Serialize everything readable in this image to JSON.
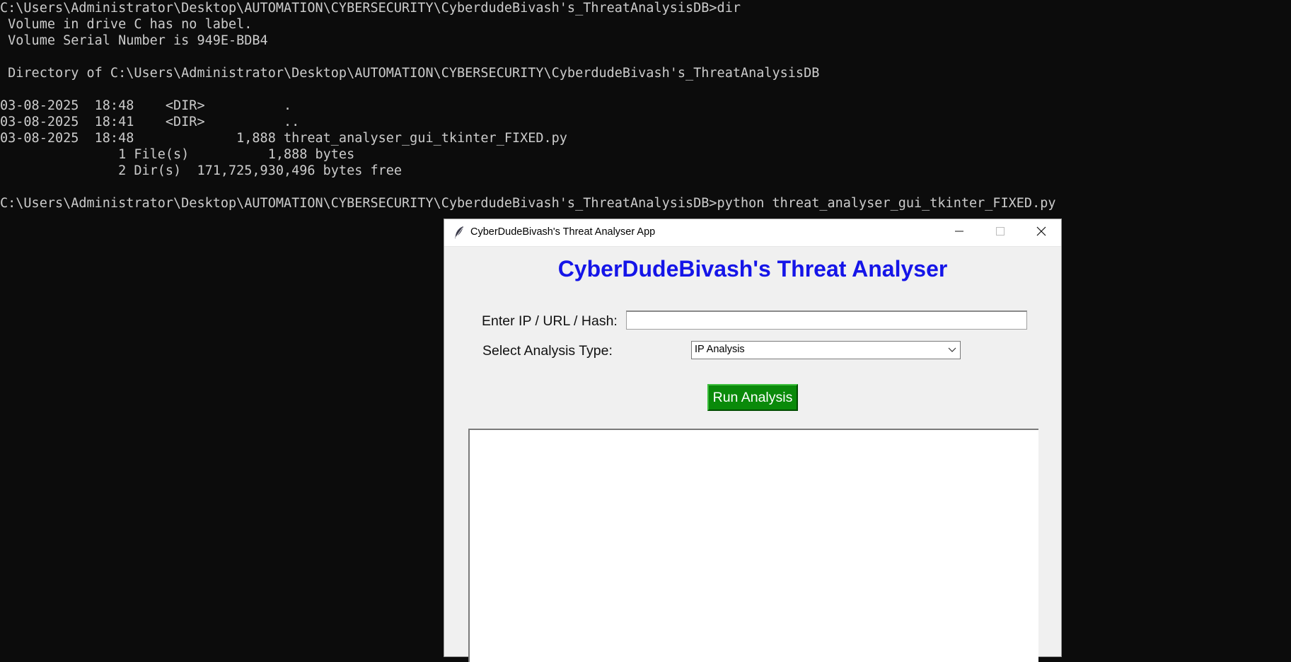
{
  "terminal": {
    "lines": [
      "C:\\Users\\Administrator\\Desktop\\AUTOMATION\\CYBERSECURITY\\CyberdudeBivash's_ThreatAnalysisDB>dir",
      " Volume in drive C has no label.",
      " Volume Serial Number is 949E-BDB4",
      "",
      " Directory of C:\\Users\\Administrator\\Desktop\\AUTOMATION\\CYBERSECURITY\\CyberdudeBivash's_ThreatAnalysisDB",
      "",
      "03-08-2025  18:48    <DIR>          .",
      "03-08-2025  18:41    <DIR>          ..",
      "03-08-2025  18:48             1,888 threat_analyser_gui_tkinter_FIXED.py",
      "               1 File(s)          1,888 bytes",
      "               2 Dir(s)  171,725,930,496 bytes free",
      "",
      "C:\\Users\\Administrator\\Desktop\\AUTOMATION\\CYBERSECURITY\\CyberdudeBivash's_ThreatAnalysisDB>python threat_analyser_gui_tkinter_FIXED.py"
    ]
  },
  "app": {
    "window_title": "CyberDudeBivash's Threat Analyser App",
    "heading": "CyberDudeBivash's Threat Analyser",
    "input_label": "Enter IP / URL / Hash:",
    "input_value": "",
    "select_label": "Select Analysis Type:",
    "select_value": "IP Analysis",
    "run_button": "Run Analysis",
    "output_text": ""
  },
  "colors": {
    "terminal_bg": "#0c0c0c",
    "terminal_fg": "#cccccc",
    "heading": "#1515e8",
    "run_button_bg": "#0a8a0a",
    "run_button_fg": "#ffffff",
    "window_bg": "#f0f0f0"
  },
  "icons": {
    "app_icon": "feather-icon",
    "minimize": "minimize-icon",
    "maximize": "maximize-icon",
    "close": "close-icon",
    "select_arrow": "chevron-down-icon"
  }
}
